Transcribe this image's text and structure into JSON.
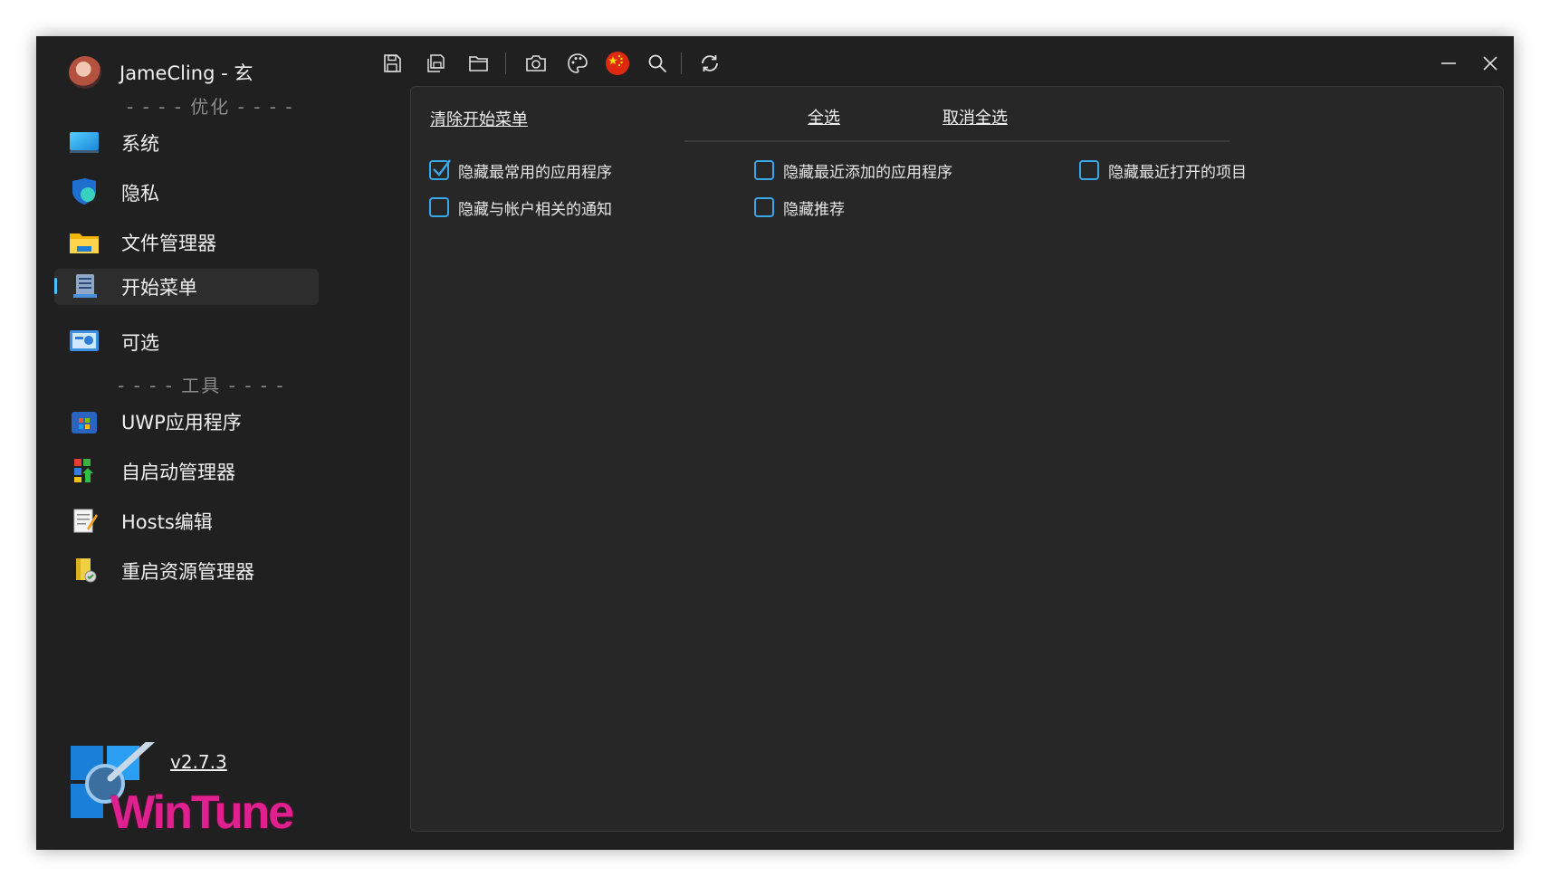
{
  "user": {
    "name": "JameCling - 玄"
  },
  "sidebar": {
    "section_optimize": "- - - - 优化 - - - -",
    "section_tools": "- - - - 工具 - - - -",
    "items": [
      {
        "label": "系统",
        "icon": "system-monitor-icon"
      },
      {
        "label": "隐私",
        "icon": "privacy-shield-icon"
      },
      {
        "label": "文件管理器",
        "icon": "folder-icon"
      },
      {
        "label": "开始菜单",
        "icon": "start-menu-icon",
        "active": true
      },
      {
        "label": "可选",
        "icon": "optional-features-icon"
      },
      {
        "label": "UWP应用程序",
        "icon": "uwp-store-icon"
      },
      {
        "label": "自启动管理器",
        "icon": "startup-manager-icon"
      },
      {
        "label": "Hosts编辑",
        "icon": "hosts-edit-icon"
      },
      {
        "label": "重启资源管理器",
        "icon": "restart-explorer-icon"
      }
    ],
    "version": "v2.7.3",
    "logo_text": "WinTune"
  },
  "toolbar": {
    "icons": [
      "save-icon",
      "save-all-icon",
      "open-folder-icon",
      "screenshot-icon",
      "theme-palette-icon",
      "language-flag-icon",
      "search-icon",
      "refresh-icon"
    ]
  },
  "window_controls": {
    "minimize": "minimize-icon",
    "close": "close-icon"
  },
  "main": {
    "title_link": "清除开始菜单",
    "select_all": "全选",
    "deselect_all": "取消全选",
    "options": [
      {
        "label": "隐藏最常用的应用程序",
        "checked": true
      },
      {
        "label": "隐藏最近添加的应用程序",
        "checked": false
      },
      {
        "label": "隐藏最近打开的项目",
        "checked": false
      },
      {
        "label": "隐藏与帐户相关的通知",
        "checked": false
      },
      {
        "label": "隐藏推荐",
        "checked": false
      }
    ]
  },
  "colors": {
    "accent": "#4cc2ff",
    "checkbox": "#3aa8e8",
    "background": "#202020",
    "panel": "#272727",
    "logo_pink": "#e0208f"
  }
}
